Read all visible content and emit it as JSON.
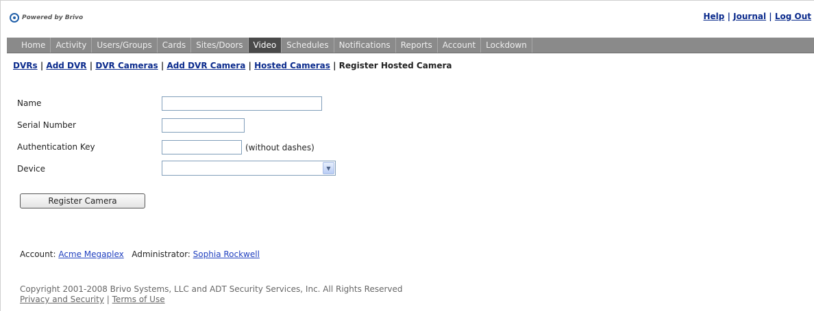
{
  "header": {
    "logo_text": "Powered by Brivo",
    "links": {
      "help": "Help",
      "journal": "Journal",
      "logout": "Log Out"
    },
    "separator": "|"
  },
  "nav": {
    "items": [
      "Home",
      "Activity",
      "Users/Groups",
      "Cards",
      "Sites/Doors",
      "Video",
      "Schedules",
      "Notifications",
      "Reports",
      "Account",
      "Lockdown"
    ],
    "active": "Video"
  },
  "subnav": {
    "links": [
      "DVRs",
      "Add DVR",
      "DVR Cameras",
      "Add DVR Camera",
      "Hosted Cameras"
    ],
    "current": "Register Hosted Camera"
  },
  "form": {
    "name_label": "Name",
    "name_value": "",
    "serial_label": "Serial Number",
    "serial_value": "",
    "auth_label": "Authentication Key",
    "auth_value": "",
    "auth_hint": "(without dashes)",
    "device_label": "Device",
    "device_selected": "",
    "submit_label": "Register Camera"
  },
  "footer": {
    "account_label": "Account:",
    "account_name": "Acme Megaplex",
    "admin_label": "Administrator:",
    "admin_name": "Sophia Rockwell",
    "copyright": "Copyright 2001-2008 Brivo Systems, LLC and ADT Security Services, Inc. All Rights Reserved",
    "privacy_link": "Privacy and Security",
    "terms_link": "Terms of Use"
  },
  "colors": {
    "link": "#0a2a8c",
    "nav_bg": "#8a8a8a",
    "nav_active": "#4a4a4a"
  }
}
